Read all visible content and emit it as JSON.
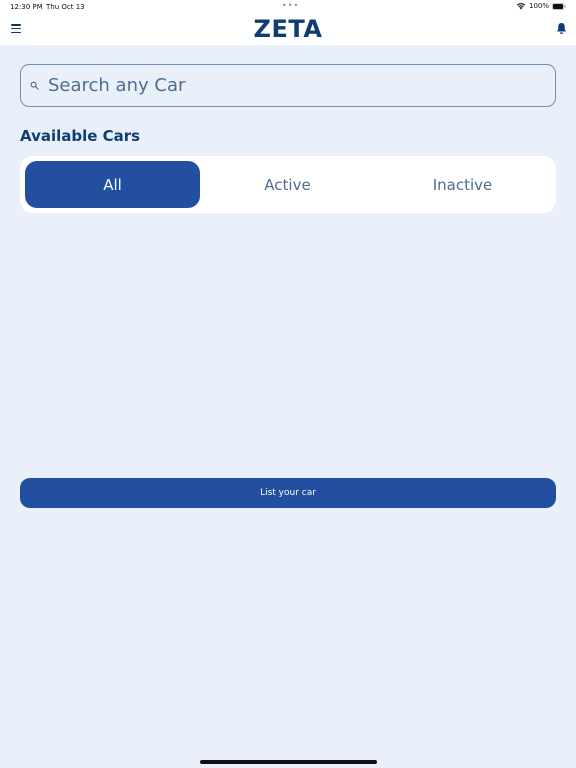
{
  "status_bar": {
    "time": "12:30 PM",
    "date": "Thu Oct 13",
    "dots": "•••",
    "battery": "100%"
  },
  "header": {
    "title": "ZETA",
    "menu_icon": "hamburger-menu-icon",
    "bell_icon": "bell-icon"
  },
  "search": {
    "placeholder": "Search any Car",
    "value": "",
    "icon": "search-icon"
  },
  "section": {
    "title": "Available Cars"
  },
  "filter": {
    "selected": "All",
    "options": [
      "All",
      "Active",
      "Inactive"
    ]
  },
  "actions": {
    "list_car_label": "List your car"
  },
  "colors": {
    "background": "#eaf0f9",
    "primary": "#234fa1",
    "title": "#0f3d73",
    "muted_text": "#4f6d8f"
  }
}
